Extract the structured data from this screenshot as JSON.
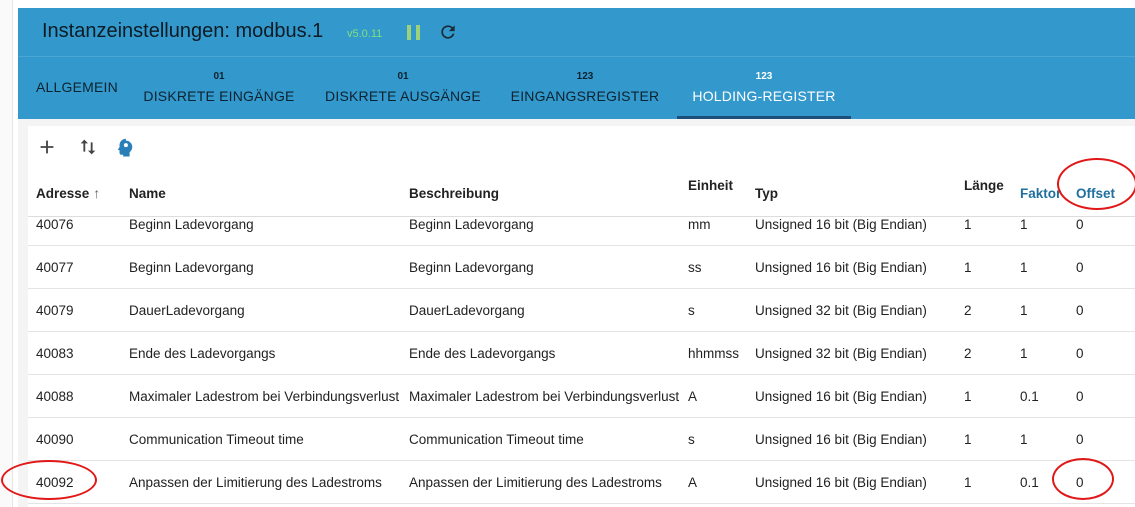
{
  "header": {
    "title": "Instanzeinstellungen: modbus.1",
    "version": "v5.0.11"
  },
  "tabs": [
    {
      "small": "",
      "label": "ALLGEMEIN"
    },
    {
      "small": "01",
      "label": "DISKRETE EINGÄNGE"
    },
    {
      "small": "01",
      "label": "DISKRETE AUSGÄNGE"
    },
    {
      "small": "123",
      "label": "EINGANGSREGISTER"
    },
    {
      "small": "123",
      "label": "HOLDING-REGISTER"
    }
  ],
  "toolbar": {
    "icons": [
      "plus-icon",
      "sort-arrows-icon",
      "head-icon"
    ]
  },
  "table": {
    "columns": [
      "Adresse",
      "Name",
      "Beschreibung",
      "Einheit",
      "Typ",
      "Länge",
      "Faktor",
      "Offset"
    ],
    "rows": [
      [
        "40076",
        "Beginn Ladevorgang",
        "Beginn Ladevorgang",
        "mm",
        "Unsigned 16 bit (Big Endian)",
        "1",
        "1",
        "0"
      ],
      [
        "40077",
        "Beginn Ladevorgang",
        "Beginn Ladevorgang",
        "ss",
        "Unsigned 16 bit (Big Endian)",
        "1",
        "1",
        "0"
      ],
      [
        "40079",
        "DauerLadevorgang",
        "DauerLadevorgang",
        "s",
        "Unsigned 32 bit (Big Endian)",
        "2",
        "1",
        "0"
      ],
      [
        "40083",
        "Ende des Ladevorgangs",
        "Ende des Ladevorgangs",
        "hhmmss",
        "Unsigned 32 bit (Big Endian)",
        "2",
        "1",
        "0"
      ],
      [
        "40088",
        "Maximaler Ladestrom bei Verbindungsverlust",
        "Maximaler Ladestrom bei Verbindungsverlust",
        "A",
        "Unsigned 16 bit (Big Endian)",
        "1",
        "0.1",
        "0"
      ],
      [
        "40090",
        "Communication Timeout time",
        "Communication Timeout time",
        "s",
        "Unsigned 16 bit (Big Endian)",
        "1",
        "1",
        "0"
      ],
      [
        "40092",
        "Anpassen der Limitierung des Ladestroms",
        "Anpassen der Limitierung des Ladestroms",
        "A",
        "Unsigned 16 bit (Big Endian)",
        "1",
        "0.1",
        "0"
      ]
    ]
  },
  "colors": {
    "header_bg": "#3399cc",
    "active_tab_text": "#ffffff",
    "annotation_red": "#e01818",
    "link_blue": "#1f6f9f"
  }
}
